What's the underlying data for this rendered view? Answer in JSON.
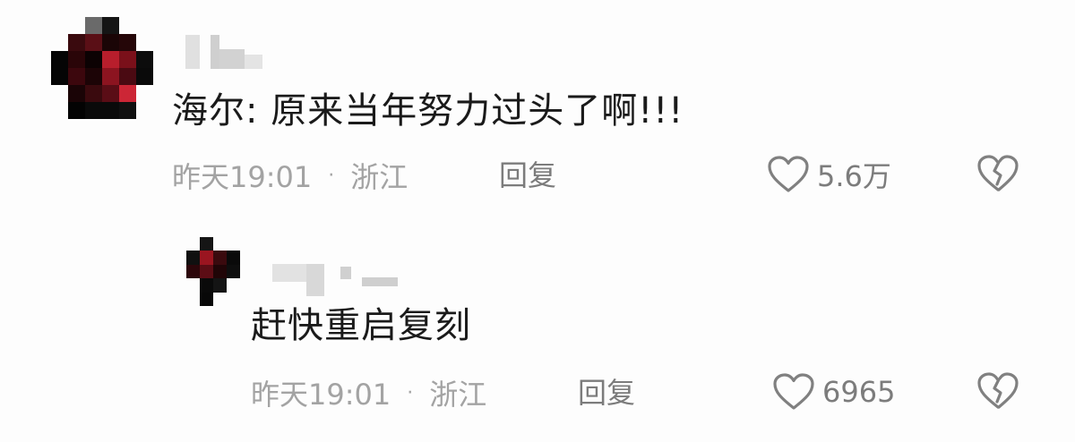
{
  "comments": [
    {
      "username": "",
      "content": "海尔: 原来当年努力过头了啊!!!",
      "time": "昨天19:01",
      "separator": "·",
      "location": "浙江",
      "reply_label": "回复",
      "likes": "5.6万"
    },
    {
      "username": "",
      "content": "赶快重启复刻",
      "time": "昨天19:01",
      "separator": "·",
      "location": "浙江",
      "reply_label": "回复",
      "likes": "6965"
    }
  ],
  "icons": {
    "like": "heart-outline-icon",
    "dislike": "broken-heart-icon"
  },
  "colors": {
    "text": "#1a1a1a",
    "meta": "#a3a3a3",
    "action": "#7c7c7c",
    "background": "#fdfdfd"
  }
}
